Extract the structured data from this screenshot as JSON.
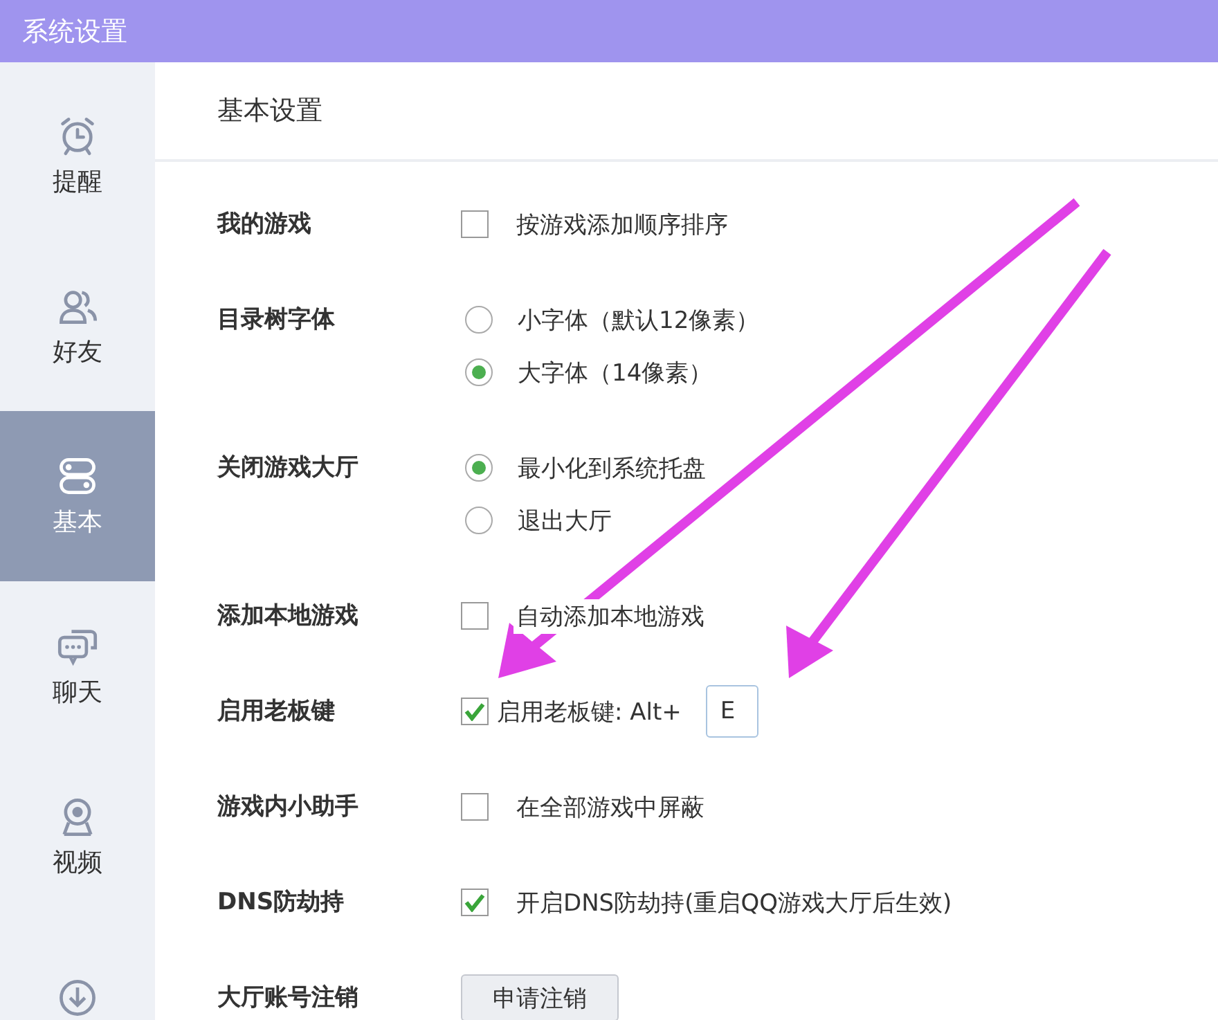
{
  "window": {
    "title": "系统设置"
  },
  "sidebar": {
    "items": [
      {
        "label": "提醒",
        "selected": false
      },
      {
        "label": "好友",
        "selected": false
      },
      {
        "label": "基本",
        "selected": true
      },
      {
        "label": "聊天",
        "selected": false
      },
      {
        "label": "视频",
        "selected": false
      },
      {
        "selected": false
      }
    ]
  },
  "section": {
    "title": "基本设置"
  },
  "rows": [
    {
      "label": "我的游戏",
      "controls": [
        {
          "kind": "checkbox",
          "text": "按游戏添加顺序排序",
          "checked": false
        }
      ]
    },
    {
      "label": "目录树字体",
      "controls": [
        {
          "kind": "radio",
          "text": "小字体（默认12像素）",
          "selected": false
        },
        {
          "kind": "radio",
          "text": "大字体（14像素）",
          "selected": true
        }
      ]
    },
    {
      "label": "关闭游戏大厅",
      "controls": [
        {
          "kind": "radio",
          "text": "最小化到系统托盘",
          "selected": true
        },
        {
          "kind": "radio",
          "text": "退出大厅",
          "selected": false
        }
      ]
    },
    {
      "label": "添加本地游戏",
      "controls": [
        {
          "kind": "checkbox",
          "text": "自动添加本地游戏",
          "checked": false
        }
      ]
    },
    {
      "label": "启用老板键",
      "controls": [
        {
          "kind": "hotkey",
          "text": "启用老板键: Alt+",
          "checked": true,
          "value": "E"
        }
      ]
    },
    {
      "label": "游戏内小助手",
      "controls": [
        {
          "kind": "checkbox",
          "text": "在全部游戏中屏蔽",
          "checked": false
        }
      ]
    },
    {
      "label": "DNS防劫持",
      "controls": [
        {
          "kind": "checkbox",
          "text": "开启DNS防劫持(重启QQ游戏大厅后生效)",
          "checked": true
        }
      ]
    },
    {
      "label": "大厅账号注销",
      "controls": [
        {
          "kind": "button",
          "text": "申请注销"
        }
      ]
    }
  ]
}
